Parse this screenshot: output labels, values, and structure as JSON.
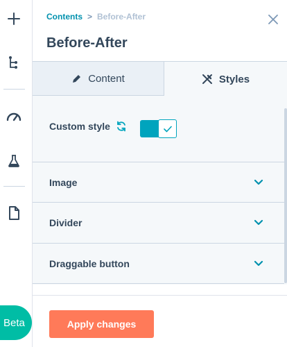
{
  "breadcrumb": {
    "parent": "Contents",
    "separator": ">",
    "current": "Before-After"
  },
  "title": "Before-After",
  "tabs": [
    {
      "label": "Content",
      "icon": "pencil-icon",
      "active": false
    },
    {
      "label": "Styles",
      "icon": "styles-icon",
      "active": true
    }
  ],
  "custom_style": {
    "label": "Custom style",
    "enabled": true
  },
  "sections": [
    {
      "label": "Image"
    },
    {
      "label": "Divider"
    },
    {
      "label": "Draggable button"
    }
  ],
  "footer": {
    "apply_label": "Apply changes"
  },
  "rail": {
    "beta_label": "Beta"
  },
  "colors": {
    "accent": "#00a4bd",
    "link": "#0091ae",
    "primary_button": "#ff7a59",
    "beta": "#00bda5",
    "text": "#33475b"
  }
}
